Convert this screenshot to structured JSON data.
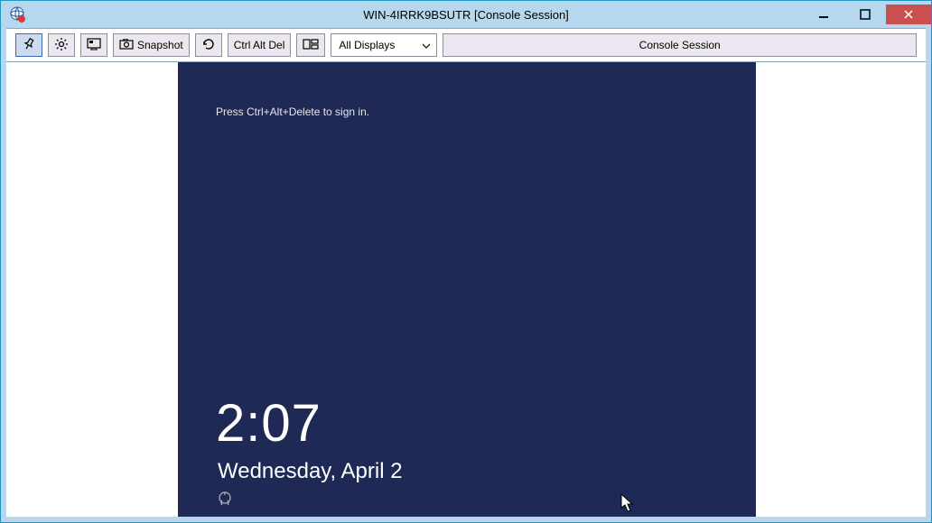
{
  "window": {
    "title": "WIN-4IRRK9BSUTR [Console Session]"
  },
  "toolbar": {
    "snapshot_label": "Snapshot",
    "ctrl_alt_del_label": "Ctrl Alt Del",
    "display_selected": "All Displays",
    "session_label": "Console Session"
  },
  "remote": {
    "signin_hint": "Press Ctrl+Alt+Delete to sign in.",
    "time": "2:07",
    "date": "Wednesday, April 2"
  }
}
